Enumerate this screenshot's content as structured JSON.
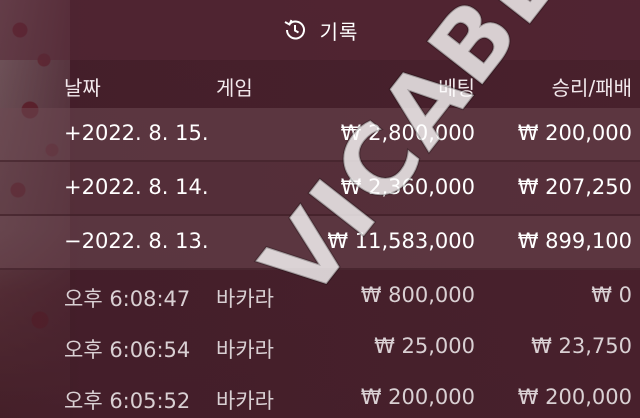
{
  "header": {
    "title": "기록",
    "icon": "history-icon"
  },
  "columns": {
    "date": "날짜",
    "game": "게임",
    "bet": "베팅",
    "win_loss": "승리/패배"
  },
  "days": [
    {
      "date": "+2022. 8. 15.",
      "bet": "₩ 2,800,000",
      "win_loss": "₩ 200,000"
    },
    {
      "date": "+2022. 8. 14.",
      "bet": "₩ 2,360,000",
      "win_loss": "₩ 207,250"
    },
    {
      "date": "−2022. 8. 13.",
      "bet": "₩ 11,583,000",
      "win_loss": "₩ 899,100"
    }
  ],
  "entries": [
    {
      "time": "오후 6:08:47",
      "game": "바카라",
      "bet": "₩ 800,000",
      "win_loss": "₩ 0"
    },
    {
      "time": "오후 6:06:54",
      "game": "바카라",
      "bet": "₩ 25,000",
      "win_loss": "₩ 23,750"
    },
    {
      "time": "오후 6:05:52",
      "game": "바카라",
      "bet": "₩ 200,000",
      "win_loss": "₩ 200,000"
    }
  ],
  "watermark": "VICABEST",
  "colors": {
    "background": "#3a1a22",
    "text": "#ffffff",
    "row_highlight": "#6e4852"
  }
}
